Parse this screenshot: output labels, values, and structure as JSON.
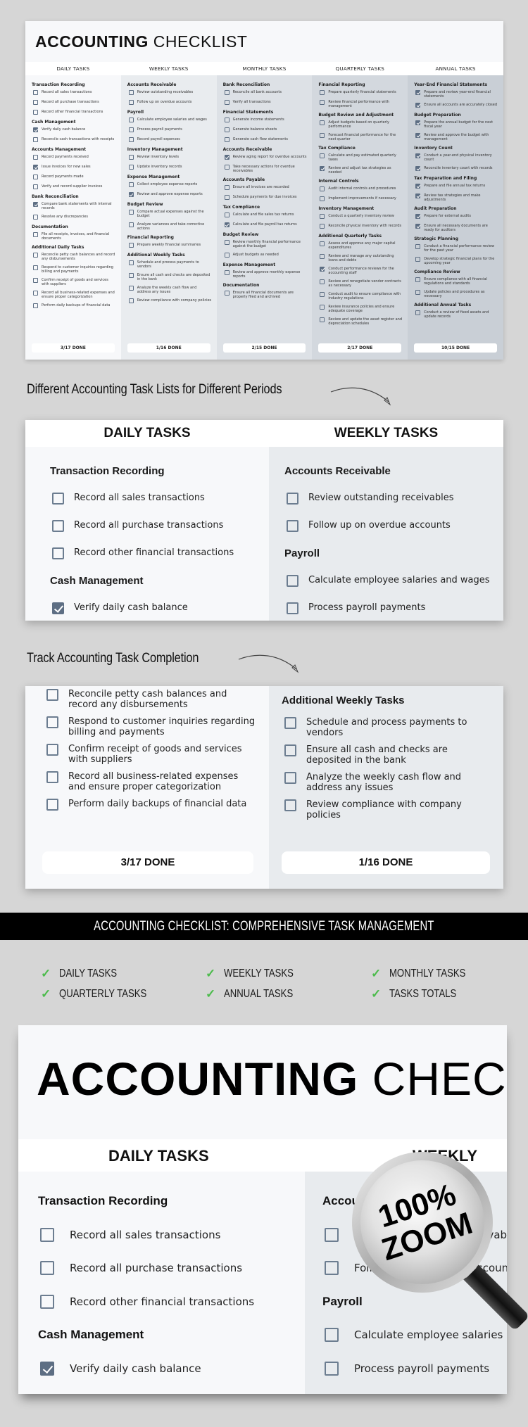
{
  "sheet": {
    "title_bold": "ACCOUNTING",
    "title_light": "CHECKLIST",
    "columns": [
      {
        "header": "DAILY TASKS",
        "done": "3/17 DONE",
        "sections": [
          {
            "title": "Transaction Recording",
            "tasks": [
              {
                "text": "Record all sales transactions",
                "checked": false
              },
              {
                "text": "Record all purchase transactions",
                "checked": false
              },
              {
                "text": "Record other financial transactions",
                "checked": false
              }
            ]
          },
          {
            "title": "Cash Management",
            "tasks": [
              {
                "text": "Verify daily cash balance",
                "checked": true
              },
              {
                "text": "Reconcile cash transactions with receipts",
                "checked": false
              }
            ]
          },
          {
            "title": "Accounts Management",
            "tasks": [
              {
                "text": "Record payments received",
                "checked": false
              },
              {
                "text": "Issue invoices for new sales",
                "checked": true
              },
              {
                "text": "Record payments made",
                "checked": false
              },
              {
                "text": "Verify and record supplier invoices",
                "checked": false
              }
            ]
          },
          {
            "title": "Bank Reconciliation",
            "tasks": [
              {
                "text": "Compare bank statements with internal records",
                "checked": true
              },
              {
                "text": "Resolve any discrepancies",
                "checked": false
              }
            ]
          },
          {
            "title": "Documentation",
            "tasks": [
              {
                "text": "File all receipts, invoices, and financial documents",
                "checked": false
              }
            ]
          },
          {
            "title": "Additional Daily Tasks",
            "tasks": [
              {
                "text": "Reconcile petty cash balances and record any disbursements",
                "checked": false
              },
              {
                "text": "Respond to customer inquiries regarding billing and payments",
                "checked": false
              },
              {
                "text": "Confirm receipt of goods and services with suppliers",
                "checked": false
              },
              {
                "text": "Record all business-related expenses and ensure proper categorization",
                "checked": false
              },
              {
                "text": "Perform daily backups of financial data",
                "checked": false
              }
            ]
          }
        ]
      },
      {
        "header": "WEEKLY TASKS",
        "done": "1/16 DONE",
        "sections": [
          {
            "title": "Accounts Receivable",
            "tasks": [
              {
                "text": "Review outstanding receivables",
                "checked": false
              },
              {
                "text": "Follow up on overdue accounts",
                "checked": false
              }
            ]
          },
          {
            "title": "Payroll",
            "tasks": [
              {
                "text": "Calculate employee salaries and wages",
                "checked": false
              },
              {
                "text": "Process payroll payments",
                "checked": false
              },
              {
                "text": "Record payroll expenses",
                "checked": false
              }
            ]
          },
          {
            "title": "Inventory Management",
            "tasks": [
              {
                "text": "Review inventory levels",
                "checked": false
              },
              {
                "text": "Update inventory records",
                "checked": false
              }
            ]
          },
          {
            "title": "Expense Management",
            "tasks": [
              {
                "text": "Collect employee expense reports",
                "checked": false
              },
              {
                "text": "Review and approve expense reports",
                "checked": true
              }
            ]
          },
          {
            "title": "Budget Review",
            "tasks": [
              {
                "text": "Compare actual expenses against the budget",
                "checked": false
              },
              {
                "text": "Analyze variances and take corrective actions",
                "checked": false
              }
            ]
          },
          {
            "title": "Financial Reporting",
            "tasks": [
              {
                "text": "Prepare weekly financial summaries",
                "checked": false
              }
            ]
          },
          {
            "title": "Additional Weekly Tasks",
            "tasks": [
              {
                "text": "Schedule and process payments to vendors",
                "checked": false
              },
              {
                "text": "Ensure all cash and checks are deposited in the bank",
                "checked": false
              },
              {
                "text": "Analyze the weekly cash flow and address any issues",
                "checked": false
              },
              {
                "text": "Review compliance with company policies",
                "checked": false
              }
            ]
          }
        ]
      },
      {
        "header": "MONTHLY TASKS",
        "done": "2/15 DONE",
        "sections": [
          {
            "title": "Bank Reconciliation",
            "tasks": [
              {
                "text": "Reconcile all bank accounts",
                "checked": false
              },
              {
                "text": "Verify all transactions",
                "checked": false
              }
            ]
          },
          {
            "title": "Financial Statements",
            "tasks": [
              {
                "text": "Generate income statements",
                "checked": false
              },
              {
                "text": "Generate balance sheets",
                "checked": false
              },
              {
                "text": "Generate cash flow statements",
                "checked": false
              }
            ]
          },
          {
            "title": "Accounts Receivable",
            "tasks": [
              {
                "text": "Review aging report for overdue accounts",
                "checked": true
              },
              {
                "text": "Take necessary actions for overdue receivables",
                "checked": false
              }
            ]
          },
          {
            "title": "Accounts Payable",
            "tasks": [
              {
                "text": "Ensure all invoices are recorded",
                "checked": false
              },
              {
                "text": "Schedule payments for due invoices",
                "checked": false
              }
            ]
          },
          {
            "title": "Tax Compliance",
            "tasks": [
              {
                "text": "Calculate and file sales tax returns",
                "checked": false
              },
              {
                "text": "Calculate and file payroll tax returns",
                "checked": true
              }
            ]
          },
          {
            "title": "Budget Review",
            "tasks": [
              {
                "text": "Review monthly financial performance against the budget",
                "checked": false
              },
              {
                "text": "Adjust budgets as needed",
                "checked": false
              }
            ]
          },
          {
            "title": "Expense Management",
            "tasks": [
              {
                "text": "Review and approve monthly expense reports",
                "checked": false
              }
            ]
          },
          {
            "title": "Documentation",
            "tasks": [
              {
                "text": "Ensure all financial documents are properly filed and archived",
                "checked": false
              }
            ]
          }
        ]
      },
      {
        "header": "QUARTERLY TASKS",
        "done": "2/17 DONE",
        "sections": [
          {
            "title": "Financial Reporting",
            "tasks": [
              {
                "text": "Prepare quarterly financial statements",
                "checked": false
              },
              {
                "text": "Review financial performance with management",
                "checked": false
              }
            ]
          },
          {
            "title": "Budget Review and Adjustment",
            "tasks": [
              {
                "text": "Adjust budgets based on quarterly performance",
                "checked": false
              },
              {
                "text": "Forecast financial performance for the next quarter",
                "checked": false
              }
            ]
          },
          {
            "title": "Tax Compliance",
            "tasks": [
              {
                "text": "Calculate and pay estimated quarterly taxes",
                "checked": false
              },
              {
                "text": "Review and adjust tax strategies as needed",
                "checked": true
              }
            ]
          },
          {
            "title": "Internal Controls",
            "tasks": [
              {
                "text": "Audit internal controls and procedures",
                "checked": false
              },
              {
                "text": "Implement improvements if necessary",
                "checked": false
              }
            ]
          },
          {
            "title": "Inventory Management",
            "tasks": [
              {
                "text": "Conduct a quarterly inventory review",
                "checked": false
              },
              {
                "text": "Reconcile physical inventory with records",
                "checked": false
              }
            ]
          },
          {
            "title": "Additional Quarterly Tasks",
            "tasks": [
              {
                "text": "Assess and approve any major capital expenditures",
                "checked": false
              },
              {
                "text": "Review and manage any outstanding loans and debts",
                "checked": false
              },
              {
                "text": "Conduct performance reviews for the accounting staff",
                "checked": true
              },
              {
                "text": "Review and renegotiate vendor contracts as necessary",
                "checked": false
              },
              {
                "text": "Conduct audit to ensure compliance with industry regulations",
                "checked": false
              },
              {
                "text": "Review insurance policies and ensure adequate coverage",
                "checked": false
              },
              {
                "text": "Review and update the asset register and depreciation schedules",
                "checked": false
              }
            ]
          }
        ]
      },
      {
        "header": "ANNUAL TASKS",
        "done": "10/15 DONE",
        "sections": [
          {
            "title": "Year-End Financial Statements",
            "tasks": [
              {
                "text": "Prepare and review year-end financial statements",
                "checked": true
              },
              {
                "text": "Ensure all accounts are accurately closed",
                "checked": true
              }
            ]
          },
          {
            "title": "Budget Preparation",
            "tasks": [
              {
                "text": "Prepare the annual budget for the next fiscal year",
                "checked": true
              },
              {
                "text": "Review and approve the budget with management",
                "checked": true
              }
            ]
          },
          {
            "title": "Inventory Count",
            "tasks": [
              {
                "text": "Conduct a year-end physical inventory count",
                "checked": true
              },
              {
                "text": "Reconcile inventory count with records",
                "checked": true
              }
            ]
          },
          {
            "title": "Tax Preparation and Filing",
            "tasks": [
              {
                "text": "Prepare and file annual tax returns",
                "checked": true
              },
              {
                "text": "Review tax strategies and make adjustments",
                "checked": true
              }
            ]
          },
          {
            "title": "Audit Preparation",
            "tasks": [
              {
                "text": "Prepare for external audits",
                "checked": true
              },
              {
                "text": "Ensure all necessary documents are ready for auditors",
                "checked": true
              }
            ]
          },
          {
            "title": "Strategic Planning",
            "tasks": [
              {
                "text": "Conduct a financial performance review for the past year",
                "checked": false
              },
              {
                "text": "Develop strategic financial plans for the upcoming year",
                "checked": false
              }
            ]
          },
          {
            "title": "Compliance Review",
            "tasks": [
              {
                "text": "Ensure compliance with all financial regulations and standards",
                "checked": false
              },
              {
                "text": "Update policies and procedures as necessary",
                "checked": false
              }
            ]
          },
          {
            "title": "Additional Annual Tasks",
            "tasks": [
              {
                "text": "Conduct a review of fixed assets and update records",
                "checked": false
              }
            ]
          }
        ]
      }
    ]
  },
  "captions": {
    "periods": "Different Accounting Task Lists for Different Periods",
    "completion": "Track Accounting Task Completion"
  },
  "panel1": {
    "left_header": "DAILY TASKS",
    "right_header": "WEEKLY TASKS",
    "left": [
      {
        "kind": "sec",
        "text": "Transaction Recording"
      },
      {
        "kind": "task",
        "text": "Record all sales transactions",
        "checked": false
      },
      {
        "kind": "task",
        "text": "Record all purchase transactions",
        "checked": false
      },
      {
        "kind": "task",
        "text": "Record other financial transactions",
        "checked": false
      },
      {
        "kind": "sec",
        "text": "Cash Management"
      },
      {
        "kind": "task",
        "text": "Verify daily cash balance",
        "checked": true
      }
    ],
    "right": [
      {
        "kind": "sec",
        "text": "Accounts Receivable"
      },
      {
        "kind": "task",
        "text": "Review outstanding receivables",
        "checked": false
      },
      {
        "kind": "task",
        "text": "Follow up on overdue accounts",
        "checked": false
      },
      {
        "kind": "sec",
        "text": "Payroll"
      },
      {
        "kind": "task",
        "text": "Calculate employee salaries and wages",
        "checked": false
      },
      {
        "kind": "task",
        "text": "Process payroll payments",
        "checked": false
      }
    ]
  },
  "panel2": {
    "left": [
      {
        "text": "Reconcile petty cash balances and record any disbursements",
        "checked": false
      },
      {
        "text": "Respond to customer inquiries regarding billing and payments",
        "checked": false
      },
      {
        "text": "Confirm receipt of goods and services with suppliers",
        "checked": false
      },
      {
        "text": "Record all business-related expenses and ensure proper categorization",
        "checked": false
      },
      {
        "text": "Perform daily backups of financial data",
        "checked": false
      }
    ],
    "right_section": "Additional Weekly Tasks",
    "right": [
      {
        "text": "Schedule and process payments to vendors",
        "checked": false
      },
      {
        "text": "Ensure all cash and checks are deposited in the bank",
        "checked": false
      },
      {
        "text": "Analyze the weekly cash flow and address any issues",
        "checked": false
      },
      {
        "text": "Review compliance with company policies",
        "checked": false
      }
    ],
    "left_done": "3/17 DONE",
    "right_done": "1/16 DONE"
  },
  "banner": {
    "title": "ACCOUNTING CHECKLIST: COMPREHENSIVE TASK MANAGEMENT",
    "features": [
      "DAILY TASKS",
      "WEEKLY TASKS",
      "MONTHLY TASKS",
      "QUARTERLY TASKS",
      "ANNUAL TASKS",
      "TASKS TOTALS"
    ],
    "tick_color": "#4cbb4c"
  },
  "zoom_view": {
    "title_bold": "ACCOUNTING",
    "title_light": "CHEC",
    "left_header": "DAILY TASKS",
    "right_header": "WEEKLY TASKS",
    "badge_line1": "100%",
    "badge_line2": "ZOOM",
    "left": [
      {
        "kind": "sec",
        "text": "Transaction Recording"
      },
      {
        "kind": "task",
        "text": "Record all sales transactions",
        "checked": false
      },
      {
        "kind": "task",
        "text": "Record all purchase transactions",
        "checked": false
      },
      {
        "kind": "task",
        "text": "Record other financial transactions",
        "checked": false
      },
      {
        "kind": "sec",
        "text": "Cash Management"
      },
      {
        "kind": "task",
        "text": "Verify daily cash balance",
        "checked": true
      }
    ],
    "right": [
      {
        "kind": "sec",
        "text": "Accounts Receivable"
      },
      {
        "kind": "task",
        "text": "Review outstanding receivables",
        "checked": false
      },
      {
        "kind": "task",
        "text": "Follow up on overdue accounts",
        "checked": false
      },
      {
        "kind": "sec",
        "text": "Payroll"
      },
      {
        "kind": "task",
        "text": "Calculate employee salaries and wages",
        "checked": false
      },
      {
        "kind": "task",
        "text": "Process payroll payments",
        "checked": false
      }
    ]
  },
  "colors": {
    "checkbox": "#5d6e83",
    "background": "#d6d6d6",
    "banner": "#000000"
  }
}
